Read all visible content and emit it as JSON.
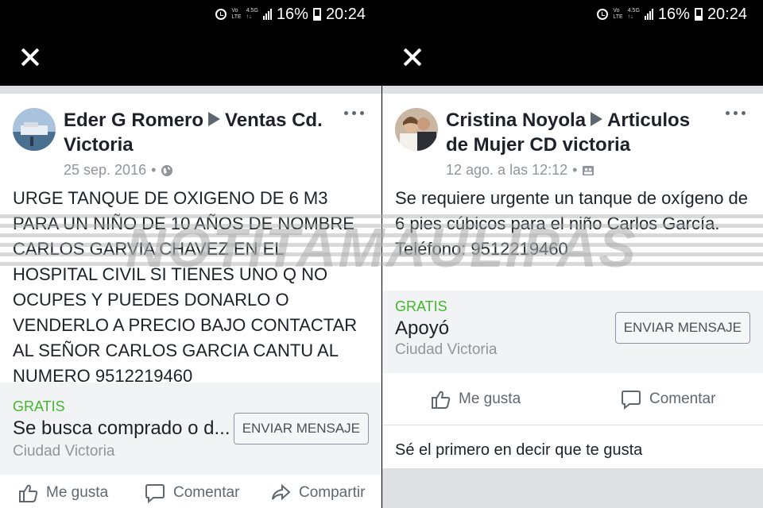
{
  "left": {
    "status": {
      "net_top": "Vo",
      "net_bottom": "LTE",
      "gen_top": "4.5G",
      "gen_bottom": "↑↓",
      "battery": "16%",
      "time": "20:24"
    },
    "post": {
      "author": "Eder G Romero",
      "group": "Ventas Cd. Victoria",
      "date": "25 sep. 2016",
      "privacy_icon": "globe-icon",
      "text": "URGE TANQUE DE OXIGENO  DE 6 M3 PARA UN NIÑO DE 10 AÑOS DE NOMBRE CARLOS GARVIA CHAVEZ EN EL HOSPITAL CIVIL SI TIENES UNO Q NO OCUPES Y PUEDES DONARLO O VENDERLO A PRECIO BAJO CONTACTAR AL SEÑOR CARLOS GARCIA CANTU AL NUMERO 9512219460"
    },
    "listing": {
      "price": "GRATIS",
      "title": "Se busca comprado o d...",
      "location": "Ciudad Victoria",
      "button": "ENVIAR MENSAJE"
    },
    "actions": {
      "like": "Me gusta",
      "comment": "Comentar",
      "share": "Compartir"
    }
  },
  "right": {
    "status": {
      "net_top": "Vo",
      "net_bottom": "LTE",
      "gen_top": "4.5G",
      "gen_bottom": "↑↓",
      "battery": "16%",
      "time": "20:24"
    },
    "post": {
      "author": "Cristina Noyola",
      "group": "Articulos de Mujer CD victoria",
      "date": "12 ago. a las 12:12",
      "privacy_icon": "group-icon",
      "text": "Se requiere urgente un tanque de oxígeno de 6 pies cúbicos para el niño Carlos García. Teléfono: 9512219460"
    },
    "listing": {
      "price": "GRATIS",
      "title": "Apoyó",
      "location": "Ciudad Victoria",
      "button": "ENVIAR MENSAJE"
    },
    "actions": {
      "like": "Me gusta",
      "comment": "Comentar"
    },
    "first_to_like": "Sé el primero en decir que te gusta"
  },
  "watermark": "NOTITAMAULIPAS"
}
